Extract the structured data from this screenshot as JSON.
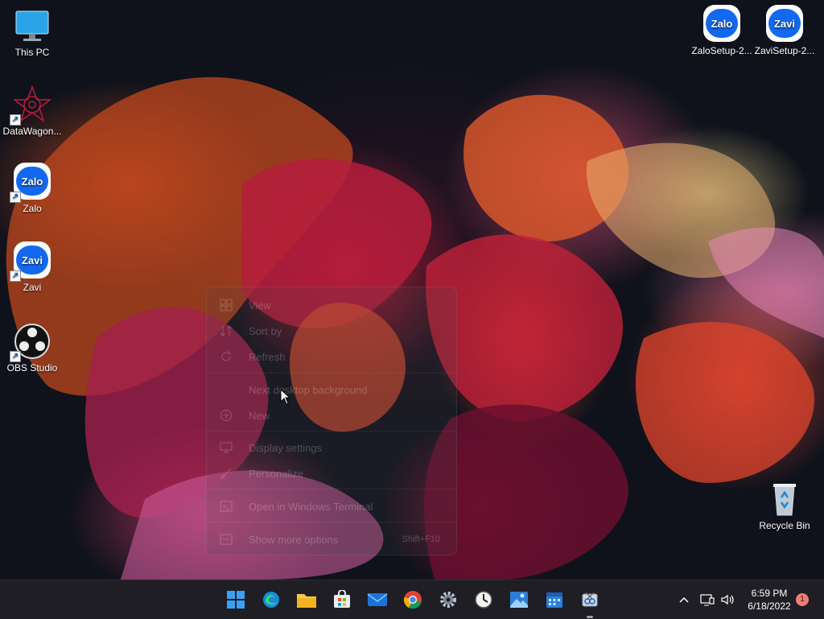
{
  "desktop": {
    "icons": [
      {
        "label": "This PC",
        "icon": "monitor-icon"
      },
      {
        "label": "DataWagon...",
        "icon": "datawagon-icon"
      },
      {
        "label": "Zalo",
        "icon": "zalo-icon",
        "glyph": "Zalo"
      },
      {
        "label": "Zavi",
        "icon": "zavi-icon",
        "glyph": "Zavi"
      },
      {
        "label": "OBS Studio",
        "icon": "obs-icon"
      },
      {
        "label": "ZaloSetup-2...",
        "icon": "zalo-setup-icon",
        "glyph": "Zalo"
      },
      {
        "label": "ZaviSetup-2...",
        "icon": "zavi-setup-icon",
        "glyph": "Zavi"
      },
      {
        "label": "Recycle Bin",
        "icon": "recycle-bin-icon"
      }
    ]
  },
  "context_menu": {
    "items": [
      {
        "label": "View",
        "icon": "grid-icon"
      },
      {
        "label": "Sort by",
        "icon": "sort-icon"
      },
      {
        "label": "Refresh",
        "icon": "refresh-icon"
      },
      {
        "label": "Next desktop background",
        "icon": ""
      },
      {
        "label": "New",
        "icon": "plus-circle-icon"
      },
      {
        "label": "Display settings",
        "icon": "display-icon"
      },
      {
        "label": "Personalize",
        "icon": "brush-icon"
      },
      {
        "label": "Open in Windows Terminal",
        "icon": "terminal-icon"
      },
      {
        "label": "Show more options",
        "icon": "more-options-icon",
        "shortcut": "Shift+F10"
      }
    ]
  },
  "taskbar": {
    "apps": [
      {
        "name": "Start",
        "icon": "windows-start-icon"
      },
      {
        "name": "Microsoft Edge",
        "icon": "edge-icon"
      },
      {
        "name": "File Explorer",
        "icon": "folder-icon"
      },
      {
        "name": "Microsoft Store",
        "icon": "store-icon"
      },
      {
        "name": "Mail",
        "icon": "mail-icon"
      },
      {
        "name": "Google Chrome",
        "icon": "chrome-icon"
      },
      {
        "name": "Settings",
        "icon": "gear-icon"
      },
      {
        "name": "Clock",
        "icon": "clock-icon"
      },
      {
        "name": "Photos",
        "icon": "photos-icon"
      },
      {
        "name": "Calendar",
        "icon": "calendar-icon"
      },
      {
        "name": "Snipping Tool",
        "icon": "snip-icon"
      }
    ],
    "tray": {
      "time": "6:59 PM",
      "date": "6/18/2022",
      "notification_count": "1"
    }
  },
  "colors": {
    "taskbar_bg": "#1e1e24",
    "accent_blue": "#1269f0",
    "notification_badge": "#f47b70"
  }
}
